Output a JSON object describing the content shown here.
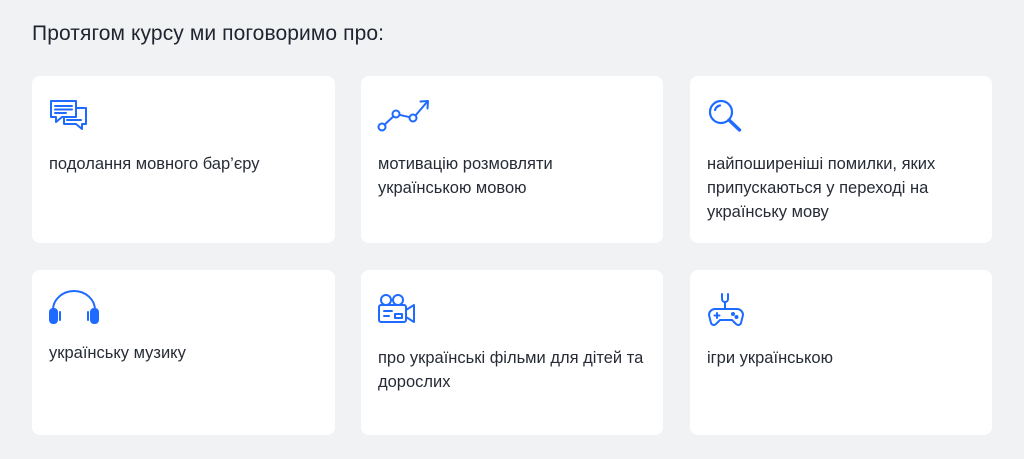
{
  "heading": "Протягом курсу ми поговоримо про:",
  "accent_color": "#1f6bff",
  "cards": [
    {
      "icon": "chat-bubbles-icon",
      "text": "подолання мовного бар’єру"
    },
    {
      "icon": "growth-chart-icon",
      "text": "мотивацію розмовляти українською мовою"
    },
    {
      "icon": "search-icon",
      "text": "найпоширеніші помилки, яких припускаються у переході на українську мову"
    },
    {
      "icon": "headphones-icon",
      "text": "українську музику"
    },
    {
      "icon": "video-camera-icon",
      "text": "про українські фільми для дітей та дорослих"
    },
    {
      "icon": "gamepad-icon",
      "text": "ігри українською"
    }
  ]
}
